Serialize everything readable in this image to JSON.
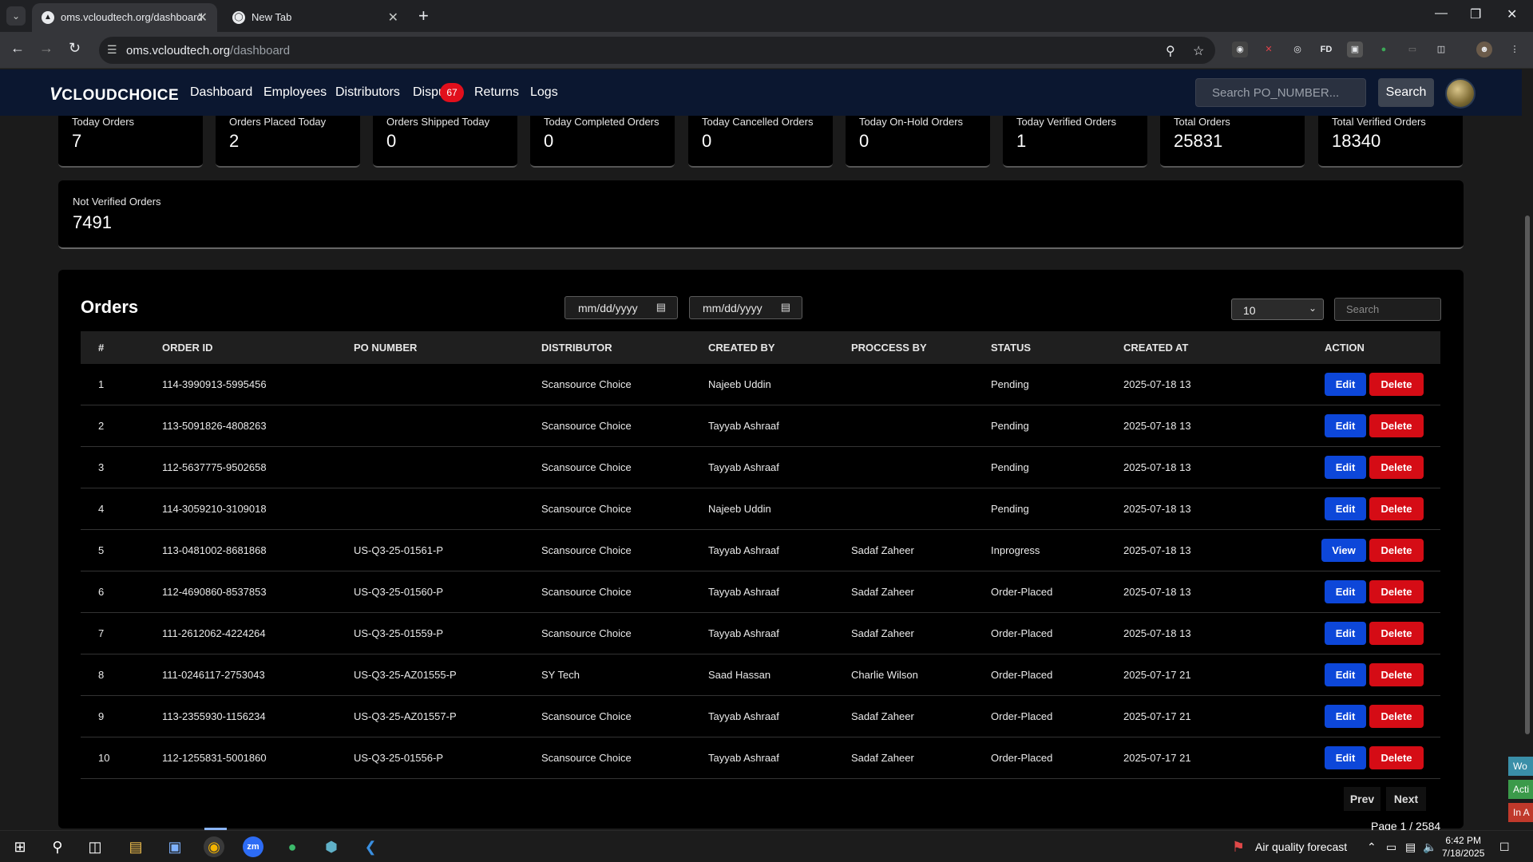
{
  "browser": {
    "tabs": [
      {
        "title": "oms.vcloudtech.org/dashboard"
      },
      {
        "title": "New Tab"
      }
    ],
    "url_host": "oms.vcloudtech.org",
    "url_path": "/dashboard"
  },
  "app": {
    "logo": "CLOUDCHOICE",
    "logo_mark": "V",
    "nav": [
      "Dashboard",
      "Employees",
      "Distributors",
      "Dispu",
      "Returns",
      "Logs"
    ],
    "disputes_badge": "67",
    "search_placeholder": "Search PO_NUMBER...",
    "search_button": "Search"
  },
  "stats": [
    {
      "label": "Today Orders",
      "value": "7"
    },
    {
      "label": "Orders Placed Today",
      "value": "2"
    },
    {
      "label": "Orders Shipped Today",
      "value": "0"
    },
    {
      "label": "Today Completed Orders",
      "value": "0"
    },
    {
      "label": "Today Cancelled Orders",
      "value": "0"
    },
    {
      "label": "Today On-Hold Orders",
      "value": "0"
    },
    {
      "label": "Today Verified Orders",
      "value": "1"
    },
    {
      "label": "Total Orders",
      "value": "25831"
    },
    {
      "label": "Total Verified Orders",
      "value": "18340"
    }
  ],
  "not_verified": {
    "label": "Not Verified Orders",
    "value": "7491"
  },
  "orders": {
    "title": "Orders",
    "date_from_placeholder": "mm/dd/yyyy",
    "date_to_placeholder": "mm/dd/yyyy",
    "per_page": "10",
    "search_placeholder": "Search",
    "columns": [
      "#",
      "ORDER ID",
      "PO NUMBER",
      "DISTRIBUTOR",
      "CREATED BY",
      "PROCCESS BY",
      "STATUS",
      "CREATED AT",
      "ACTION"
    ],
    "rows": [
      {
        "n": "1",
        "order_id": "114-3990913-5995456",
        "po": "",
        "distributor": "Scansource Choice",
        "created_by": "Najeeb Uddin",
        "process_by": "",
        "status": "Pending",
        "created_at": "2025-07-18 13",
        "primary_action": "Edit"
      },
      {
        "n": "2",
        "order_id": "113-5091826-4808263",
        "po": "",
        "distributor": "Scansource Choice",
        "created_by": "Tayyab Ashraaf",
        "process_by": "",
        "status": "Pending",
        "created_at": "2025-07-18 13",
        "primary_action": "Edit"
      },
      {
        "n": "3",
        "order_id": "112-5637775-9502658",
        "po": "",
        "distributor": "Scansource Choice",
        "created_by": "Tayyab Ashraaf",
        "process_by": "",
        "status": "Pending",
        "created_at": "2025-07-18 13",
        "primary_action": "Edit"
      },
      {
        "n": "4",
        "order_id": "114-3059210-3109018",
        "po": "",
        "distributor": "Scansource Choice",
        "created_by": "Najeeb Uddin",
        "process_by": "",
        "status": "Pending",
        "created_at": "2025-07-18 13",
        "primary_action": "Edit"
      },
      {
        "n": "5",
        "order_id": "113-0481002-8681868",
        "po": "US-Q3-25-01561-P",
        "distributor": "Scansource Choice",
        "created_by": "Tayyab Ashraaf",
        "process_by": "Sadaf Zaheer",
        "status": "Inprogress",
        "created_at": "2025-07-18 13",
        "primary_action": "View"
      },
      {
        "n": "6",
        "order_id": "112-4690860-8537853",
        "po": "US-Q3-25-01560-P",
        "distributor": "Scansource Choice",
        "created_by": "Tayyab Ashraaf",
        "process_by": "Sadaf Zaheer",
        "status": "Order-Placed",
        "created_at": "2025-07-18 13",
        "primary_action": "Edit"
      },
      {
        "n": "7",
        "order_id": "111-2612062-4224264",
        "po": "US-Q3-25-01559-P",
        "distributor": "Scansource Choice",
        "created_by": "Tayyab Ashraaf",
        "process_by": "Sadaf Zaheer",
        "status": "Order-Placed",
        "created_at": "2025-07-18 13",
        "primary_action": "Edit"
      },
      {
        "n": "8",
        "order_id": "111-0246117-2753043",
        "po": "US-Q3-25-AZ01555-P",
        "distributor": "SY Tech",
        "created_by": "Saad Hassan",
        "process_by": "Charlie Wilson",
        "status": "Order-Placed",
        "created_at": "2025-07-17 21",
        "primary_action": "Edit"
      },
      {
        "n": "9",
        "order_id": "113-2355930-1156234",
        "po": "US-Q3-25-AZ01557-P",
        "distributor": "Scansource Choice",
        "created_by": "Tayyab Ashraaf",
        "process_by": "Sadaf Zaheer",
        "status": "Order-Placed",
        "created_at": "2025-07-17 21",
        "primary_action": "Edit"
      },
      {
        "n": "10",
        "order_id": "112-1255831-5001860",
        "po": "US-Q3-25-01556-P",
        "distributor": "Scansource Choice",
        "created_by": "Tayyab Ashraaf",
        "process_by": "Sadaf Zaheer",
        "status": "Order-Placed",
        "created_at": "2025-07-17 21",
        "primary_action": "Edit"
      }
    ],
    "delete_label": "Delete",
    "prev_label": "Prev",
    "next_label": "Next",
    "page_info": "Page 1 / 2584"
  },
  "side_tabs": [
    "Wo",
    "Acti",
    "In A"
  ],
  "taskbar": {
    "weather": "Air quality forecast",
    "time": "6:42 PM",
    "date": "7/18/2025"
  },
  "colors": {
    "nav_bg": "#0b1730",
    "edit_blue": "#0d47d9",
    "delete_red": "#d50c15",
    "badge_red": "#e10f1c"
  }
}
